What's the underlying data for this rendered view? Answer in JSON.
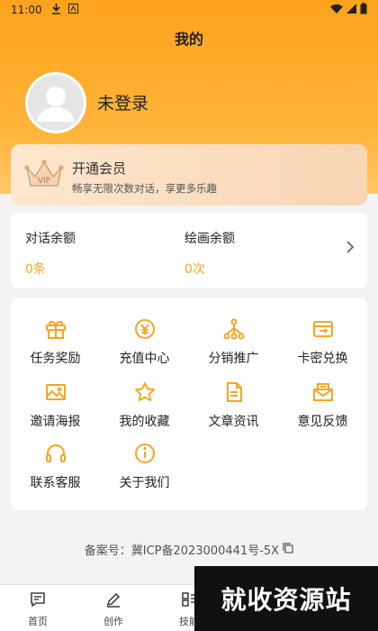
{
  "status_bar": {
    "time": "11:00"
  },
  "header": {
    "title": "我的"
  },
  "profile": {
    "login_text": "未登录"
  },
  "vip": {
    "title": "开通会员",
    "subtitle": "畅享无限次数对话，享更多乐趣",
    "badge": "VIP"
  },
  "balances": [
    {
      "label": "对话余额",
      "value": "0条"
    },
    {
      "label": "绘画余额",
      "value": "0次"
    }
  ],
  "features": [
    {
      "label": "任务奖励",
      "icon": "gift-icon"
    },
    {
      "label": "充值中心",
      "icon": "yen-coin-icon"
    },
    {
      "label": "分销推广",
      "icon": "share-tree-icon"
    },
    {
      "label": "卡密兑换",
      "icon": "card-exchange-icon"
    },
    {
      "label": "邀请海报",
      "icon": "image-poster-icon"
    },
    {
      "label": "我的收藏",
      "icon": "star-icon"
    },
    {
      "label": "文章资讯",
      "icon": "document-icon"
    },
    {
      "label": "意见反馈",
      "icon": "mail-feedback-icon"
    },
    {
      "label": "联系客服",
      "icon": "headset-icon"
    },
    {
      "label": "关于我们",
      "icon": "info-icon"
    }
  ],
  "footer": {
    "icp": "备案号：冀ICP备2023000441号-5X"
  },
  "bottom_nav": [
    {
      "label": "首页",
      "icon": "chat-home-icon"
    },
    {
      "label": "创作",
      "icon": "pen-icon"
    },
    {
      "label": "技能",
      "icon": "grid-skill-icon"
    }
  ],
  "watermark": {
    "text": "就收资源站"
  },
  "colors": {
    "accent": "#f5a623",
    "hero": "#ffa21d"
  }
}
